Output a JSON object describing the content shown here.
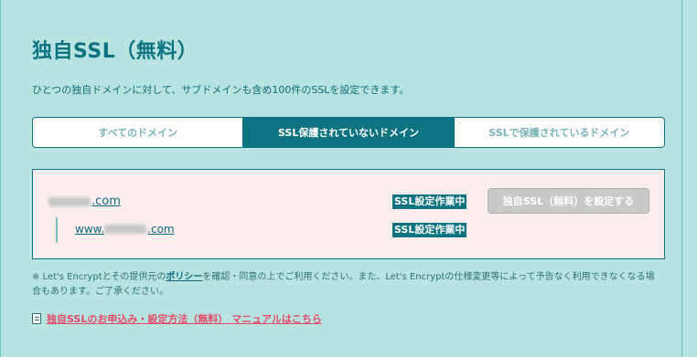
{
  "page": {
    "title": "独自SSL（無料）",
    "subtitle": "ひとつの独自ドメインに対して、サブドメインも含め100件のSSLを設定できます。"
  },
  "tabs": [
    {
      "label": "すべてのドメイン",
      "active": false
    },
    {
      "label": "SSL保護されていないドメイン",
      "active": true
    },
    {
      "label": "SSLで保護されているドメイン",
      "active": false
    }
  ],
  "domains": {
    "main": {
      "suffix": ".com",
      "status": "SSL設定作業中"
    },
    "sub": {
      "prefix": "www.",
      "suffix": ".com",
      "status": "SSL設定作業中"
    },
    "setup_button_label": "独自SSL（無料）を設定する"
  },
  "note": {
    "prefix": "※ Let's Encryptとその提供元の",
    "policy_link": "ポリシー",
    "suffix": "を確認・同意の上でご利用ください。また、Let's Encryptの仕様変更等によって予告なく利用できなくなる場合もあります。ご了承ください。"
  },
  "manual": {
    "icon": "document-icon",
    "link_label": "独自SSLのお申込み・設定方法（無料） マニュアルはこちら"
  },
  "colors": {
    "background": "#b7e4e1",
    "accent": "#0d7381",
    "panel": "#fdeeee",
    "link_pink": "#e34a67",
    "disabled": "#c9c9c9"
  }
}
